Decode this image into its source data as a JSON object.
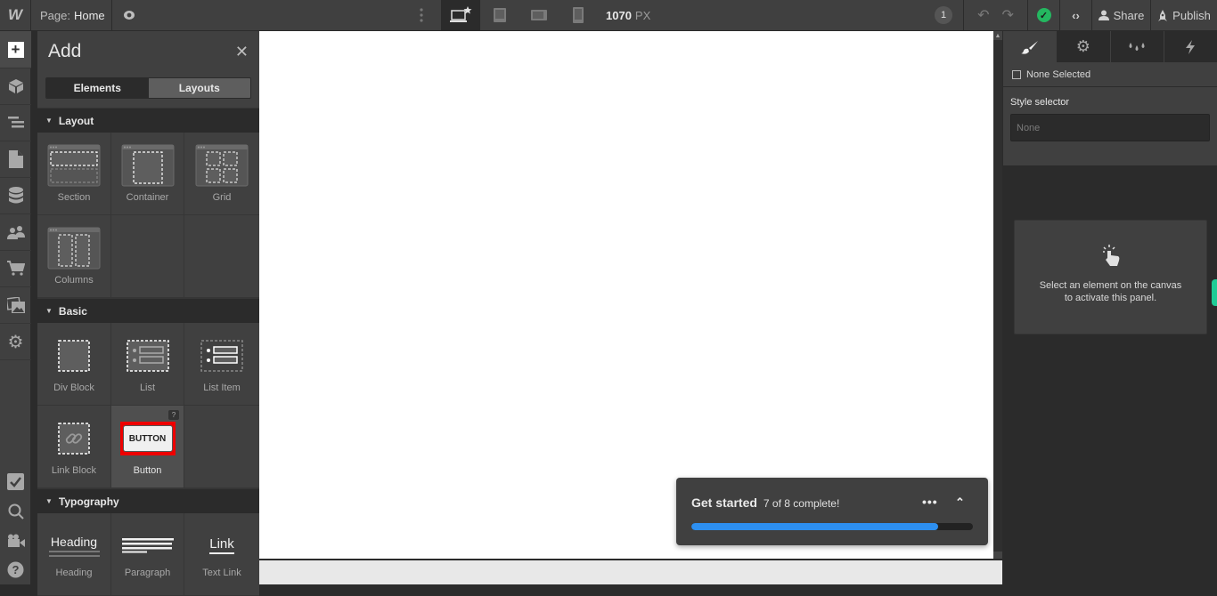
{
  "topbar": {
    "logo": "W",
    "page_label": "Page:",
    "page_name": "Home",
    "breakpoint_width": "1070",
    "breakpoint_unit": "PX",
    "notification_count": "1",
    "share_label": "Share",
    "publish_label": "Publish",
    "breakpoints": [
      "desktop-base",
      "tablet",
      "mobile-landscape",
      "mobile-portrait"
    ]
  },
  "leftbar": {
    "items": [
      "add",
      "navigator-box",
      "navigator-layers",
      "pages",
      "cms",
      "users",
      "ecommerce",
      "assets",
      "settings"
    ],
    "bottom_items": [
      "audit",
      "search",
      "video-tutorials",
      "help"
    ]
  },
  "add_panel": {
    "title": "Add",
    "tabs": [
      {
        "label": "Elements",
        "active": true
      },
      {
        "label": "Layouts",
        "active": false
      }
    ],
    "sections": [
      {
        "title": "Layout",
        "items": [
          {
            "label": "Section"
          },
          {
            "label": "Container"
          },
          {
            "label": "Grid"
          },
          {
            "label": "Columns"
          }
        ]
      },
      {
        "title": "Basic",
        "items": [
          {
            "label": "Div Block"
          },
          {
            "label": "List"
          },
          {
            "label": "List Item"
          },
          {
            "label": "Link Block"
          },
          {
            "label": "Button",
            "icon_text": "BUTTON",
            "highlighted": true,
            "help": "?"
          }
        ]
      },
      {
        "title": "Typography",
        "items": [
          {
            "label": "Heading",
            "icon_text": "Heading"
          },
          {
            "label": "Paragraph"
          },
          {
            "label": "Text Link",
            "icon_text": "Link"
          }
        ]
      }
    ]
  },
  "right_panel": {
    "tabs": [
      "style",
      "settings",
      "style-manager",
      "interactions"
    ],
    "none_selected": "None Selected",
    "style_selector_label": "Style selector",
    "style_selector_placeholder": "None",
    "empty_message_line1": "Select an element on the canvas",
    "empty_message_line2": "to activate this panel."
  },
  "get_started": {
    "title": "Get started",
    "progress_text": "7 of 8 complete!",
    "progress_fraction": 0.875,
    "accent_color": "#2d8ff0"
  },
  "colors": {
    "status_ok": "#24b760",
    "highlight": "#e00000",
    "teal_tab": "#1fcc96"
  }
}
